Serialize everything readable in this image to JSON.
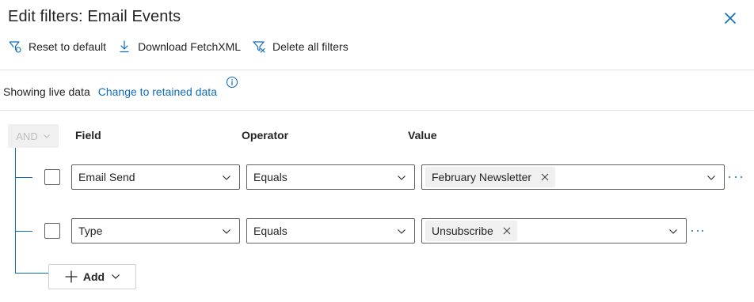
{
  "dialog": {
    "title": "Edit filters: Email Events"
  },
  "toolbar": {
    "reset_label": "Reset to default",
    "download_label": "Download FetchXML",
    "delete_label": "Delete all filters"
  },
  "data_source": {
    "status_label": "Showing live data",
    "change_link": "Change to retained data"
  },
  "filter_group": {
    "operator_label": "AND",
    "columns": {
      "field": "Field",
      "operator": "Operator",
      "value": "Value"
    },
    "rows": [
      {
        "field": "Email Send",
        "operator": "Equals",
        "value": "February Newsletter"
      },
      {
        "field": "Type",
        "operator": "Equals",
        "value": "Unsubscribe"
      }
    ],
    "add_label": "Add"
  },
  "colors": {
    "accent": "#0f6cbd",
    "text": "#242424",
    "border": "#616161",
    "disabled_bg": "#f0f0f0"
  },
  "icons": {
    "close": "dismiss-icon",
    "reset": "filter-reset-icon",
    "download": "arrow-download-icon",
    "delete": "filter-dismiss-icon",
    "info": "info-icon",
    "chevron": "chevron-down-icon",
    "more": "more-horizontal-icon",
    "add": "add-icon"
  }
}
